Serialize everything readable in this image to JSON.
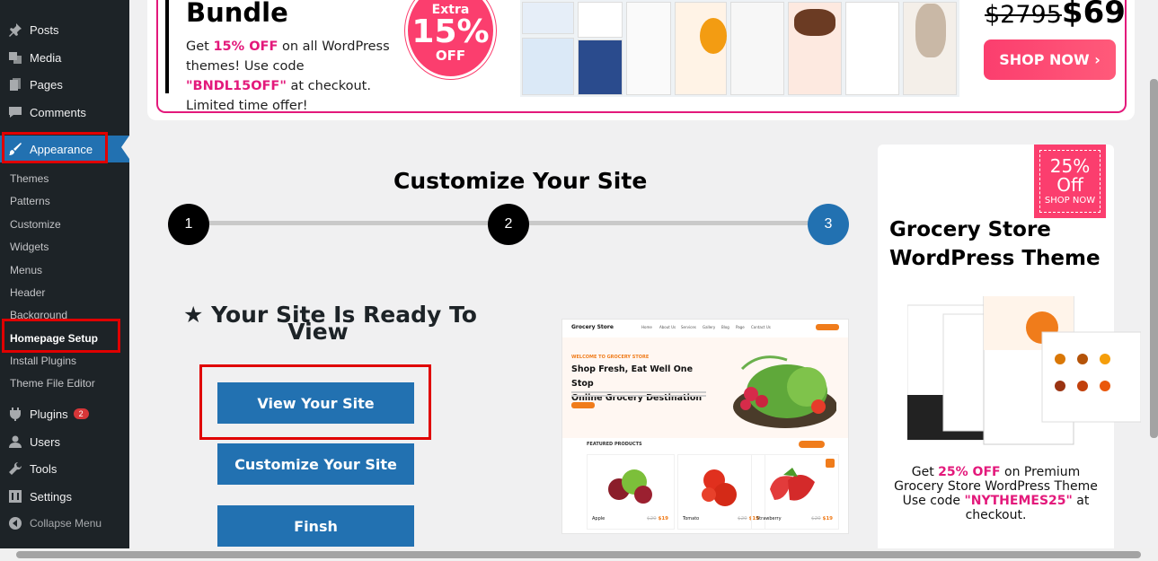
{
  "sidebar": {
    "items": [
      {
        "label": "Posts",
        "icon": "pushpin-icon"
      },
      {
        "label": "Media",
        "icon": "media-icon"
      },
      {
        "label": "Pages",
        "icon": "pages-icon"
      },
      {
        "label": "Comments",
        "icon": "comment-icon"
      },
      {
        "label": "Appearance",
        "icon": "paintbrush-icon"
      },
      {
        "label": "Plugins",
        "icon": "plugin-icon",
        "badge": "2"
      },
      {
        "label": "Users",
        "icon": "users-icon"
      },
      {
        "label": "Tools",
        "icon": "wrench-icon"
      },
      {
        "label": "Settings",
        "icon": "settings-icon"
      },
      {
        "label": "Collapse Menu",
        "icon": "collapse-icon"
      }
    ],
    "submenu": [
      "Themes",
      "Patterns",
      "Customize",
      "Widgets",
      "Menus",
      "Header",
      "Background",
      "Homepage Setup",
      "Install Plugins",
      "Theme File Editor"
    ]
  },
  "banner": {
    "title": "Bundle",
    "text_pre": "Get ",
    "text_off": "15% OFF",
    "text_mid": " on all WordPress themes! Use code ",
    "text_code": "\"BNDL15OFF\"",
    "text_post": " at checkout. Limited time offer!",
    "circle_l1": "Extra",
    "circle_l2": "15%",
    "circle_l3": "OFF",
    "price_old": "$2795",
    "price_new": "$69",
    "shop_label": "SHOP NOW",
    "shop_arrow": "›"
  },
  "stepper": {
    "title": "Customize Your Site",
    "steps": [
      "1",
      "2",
      "3"
    ]
  },
  "ready": {
    "star": "★",
    "title_line1": "Your Site Is Ready To",
    "title_line2": "View",
    "buttons": {
      "view": "View Your Site",
      "customize": "Customize Your Site",
      "finish": "Finsh"
    }
  },
  "preview": {
    "logo": "Grocery Store",
    "nav": [
      "Home",
      "About Us",
      "Services",
      "Gallery",
      "Blog",
      "Page",
      "Contact Us"
    ],
    "tag": "WELCOME TO GROCERY STORE",
    "headline1": "Shop Fresh, Eat Well One Stop",
    "headline2": "Online Grocery Destination",
    "featured": "FEATURED PRODUCTS",
    "products": [
      {
        "name": "Apple",
        "old": "$20",
        "price": "$19"
      },
      {
        "name": "Tomato",
        "old": "$20",
        "price": "$19"
      },
      {
        "name": "Strawberry",
        "old": "$20",
        "price": "$19"
      }
    ]
  },
  "promo": {
    "badge_pct": "25%",
    "badge_off": "Off",
    "badge_shop": "SHOP NOW",
    "title": "Grocery Store WordPress Theme",
    "text_pre": "Get ",
    "text_off": "25% OFF",
    "text_mid": " on Premium Grocery Store WordPress Theme Use code ",
    "text_code": "\"NYTHEMES25\"",
    "text_post": " at checkout."
  },
  "colors": {
    "wp_blue": "#2271b1",
    "sidebar_bg": "#1d2327",
    "accent_pink": "#e3197b",
    "highlight_red": "#e00000"
  }
}
